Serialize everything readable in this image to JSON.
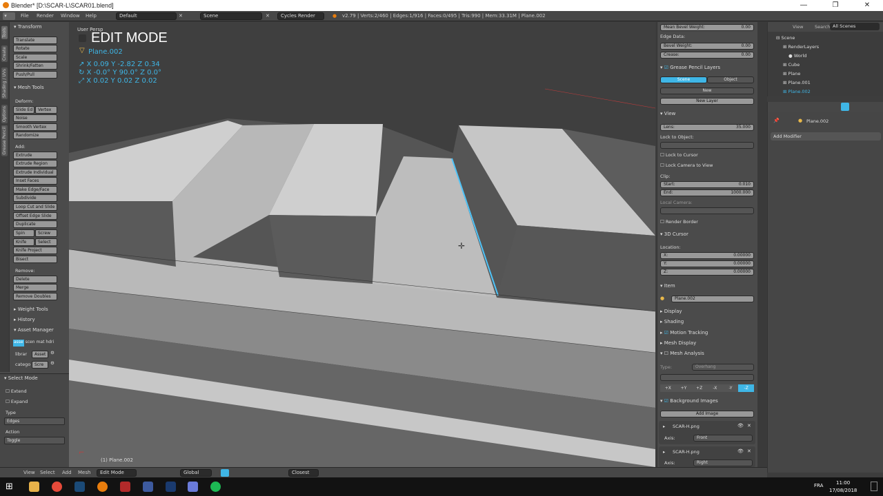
{
  "window": {
    "title": "Blender* [D:\\SCAR-L\\SCAR01.blend]",
    "controls": [
      "—",
      "❐",
      "✕"
    ]
  },
  "infobar": {
    "menus": [
      "File",
      "Render",
      "Window",
      "Help"
    ],
    "layout": "Default",
    "scene": "Scene",
    "engine": "Cycles Render",
    "stats": "v2.79 | Verts:2/460 | Edges:1/916 | Faces:0/495 | Tris:990 | Mem:33.31M | Plane.002"
  },
  "left_tabs": [
    "Tools",
    "Create",
    "Shading / UVs",
    "Options",
    "Grease Pencil"
  ],
  "tools": {
    "transform_header": "Transform",
    "transform": [
      "Translate",
      "Rotate",
      "Scale",
      "Shrink/Fatten",
      "Push/Pull"
    ],
    "mesh_tools_header": "Mesh Tools",
    "deform_label": "Deform:",
    "slide_edge": "Slide Ed",
    "vertex": "Vertex",
    "noise": "Noise",
    "smooth_vertex": "Smooth Vertex",
    "randomize": "Randomize",
    "add_label": "Add:",
    "add_items": [
      "Extrude",
      "Extrude Region",
      "Extrude Individual",
      "Inset Faces",
      "Make Edge/Face",
      "Subdivide",
      "Loop Cut and Slide",
      "Offset Edge Slide",
      "Duplicate"
    ],
    "spin": "Spin",
    "screw": "Screw",
    "knife": "Knife",
    "select": "Select",
    "knife_project": "Knife Project",
    "bisect": "Bisect",
    "remove_label": "Remove:",
    "delete": "Delete",
    "merge": "Merge",
    "remove_doubles": "Remove Doubles",
    "weight_tools": "Weight Tools",
    "history": "History",
    "asset_manager": "Asset Manager",
    "asset_tabs": [
      "asse",
      "scen",
      "mat",
      "hdri"
    ],
    "library_label": "librar",
    "library_value": "Asset",
    "category_label": "catego",
    "category_value": "Scre"
  },
  "select_mode": {
    "header": "Select Mode",
    "extend": "Extend",
    "expand": "Expand",
    "type_label": "Type",
    "type_value": "Edges",
    "action_label": "Action",
    "action_value": "Toggle"
  },
  "viewport": {
    "view_name": "User Persp",
    "mode": "EDIT MODE",
    "object": "Plane.002",
    "location": [
      "X 0.09",
      "Y -2.82",
      "Z 0.34"
    ],
    "rotation": [
      "X -0.0°",
      "Y 90.0°",
      "Z 0.0°"
    ],
    "scale": [
      "X 0.02",
      "Y 0.02",
      "Z 0.02"
    ],
    "footer_label": "(1) Plane.002"
  },
  "npanel": {
    "mean_bevel_weight_label": "Mean Bevel Weight:",
    "mean_bevel_weight": "0.00",
    "edge_data": "Edge Data:",
    "bevel_weight_label": "Bevel Weight:",
    "bevel_weight": "0.00",
    "crease_label": "Crease:",
    "crease": "0.00",
    "grease_pencil_header": "Grease Pencil Layers",
    "gp_scene": "Scene",
    "gp_object": "Object",
    "gp_new": "New",
    "gp_new_layer": "New Layer",
    "view_header": "View",
    "lens_label": "Lens:",
    "lens": "35.000",
    "lock_to_object": "Lock to Object:",
    "lock_to_cursor": "Lock to Cursor",
    "lock_camera": "Lock Camera to View",
    "clip_label": "Clip:",
    "clip_start_label": "Start:",
    "clip_start": "0.010",
    "clip_end_label": "End:",
    "clip_end": "1000.000",
    "local_camera": "Local Camera:",
    "render_border": "Render Border",
    "cursor_header": "3D Cursor",
    "location_label": "Location:",
    "cursor_x_label": "X:",
    "cursor_x": "0.00000",
    "cursor_y_label": "Y:",
    "cursor_y": "0.00000",
    "cursor_z_label": "Z:",
    "cursor_z": "0.00000",
    "item_header": "Item",
    "item_name": "Plane.002",
    "display": "Display",
    "shading": "Shading",
    "motion_tracking": "Motion Tracking",
    "mesh_display": "Mesh Display",
    "mesh_analysis": "Mesh Analysis",
    "type_label": "Type:",
    "type_value": "Overhang",
    "axis_buttons": [
      "+X",
      "+Y",
      "+Z",
      "-X",
      "-Y",
      "-Z"
    ],
    "background_images": "Background Images",
    "add_image": "Add Image",
    "bg1_name": "SCAR-H.png",
    "bg1_axis_label": "Axis:",
    "bg1_axis": "Front",
    "bg2_name": "SCAR-H.png",
    "bg2_axis_label": "Axis:",
    "bg2_axis": "Right"
  },
  "outliner": {
    "view": "View",
    "search": "Search",
    "filter": "All Scenes",
    "items": [
      "Scene",
      "RenderLayers",
      "World",
      "Cube",
      "Plane",
      "Plane.001",
      "Plane.002"
    ]
  },
  "properties": {
    "object": "Plane.002",
    "add_modifier": "Add Modifier"
  },
  "bottombar": {
    "menus": [
      "View",
      "Select",
      "Add",
      "Mesh"
    ],
    "mode": "Edit Mode",
    "orientation": "Global",
    "snap": "Closest"
  },
  "taskbar": {
    "lang": "FRA",
    "time": "11:00",
    "date": "17/08/2018"
  },
  "colors": {
    "accent": "#3fb6e6",
    "selected_edge": "#4fc3f7",
    "blender_orange": "#e87d0d"
  }
}
